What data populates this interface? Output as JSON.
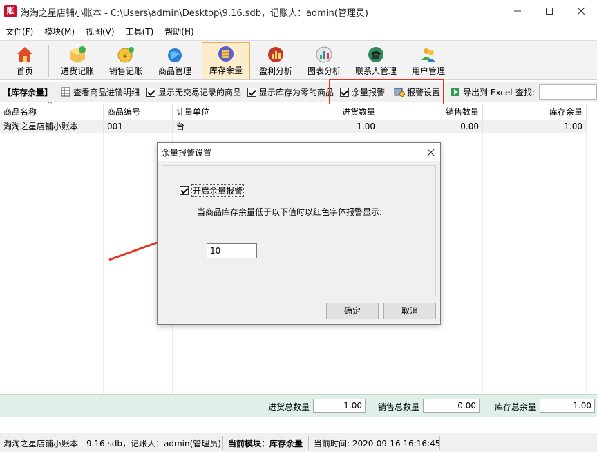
{
  "window": {
    "title": "淘淘之星店铺小账本 - C:\\Users\\admin\\Desktop\\9.16.sdb，记账人：admin(管理员)",
    "app_icon_text": "账"
  },
  "menu": [
    "文件(F)",
    "模块(M)",
    "视图(V)",
    "工具(T)",
    "帮助(H)"
  ],
  "toolbar": {
    "items": [
      "首页",
      "进货记账",
      "销售记账",
      "商品管理",
      "库存余量",
      "盈利分析",
      "图表分析",
      "联系人管理",
      "用户管理"
    ],
    "active": "库存余量"
  },
  "filterbar": {
    "module_label": "【库存余量】",
    "view_detail": "查看商品进销明细",
    "show_no_trade": "显示无交易记录的商品",
    "show_zero_stock": "显示库存为零的商品",
    "stock_alarm": "余量报警",
    "alarm_settings": "报警设置",
    "export_excel": "导出到 Excel",
    "search_label": "查找:",
    "search_value": ""
  },
  "table": {
    "columns": [
      "商品名称",
      "商品编号",
      "计量单位",
      "进货数量",
      "销售数量",
      "库存余量"
    ],
    "rows": [
      [
        "淘淘之星店铺小账本",
        "001",
        "台",
        "1.00",
        "0.00",
        "1.00"
      ]
    ]
  },
  "summary": {
    "in_total_label": "进货总数量",
    "in_total_value": "1.00",
    "sale_total_label": "销售总数量",
    "sale_total_value": "0.00",
    "stock_total_label": "库存总余量",
    "stock_total_value": "1.00"
  },
  "status": {
    "file_info": "淘淘之星店铺小账本 - 9.16.sdb，记账人：admin(管理员)",
    "module_label": "当前模块：",
    "module_value": "库存余量",
    "time": "当前时间: 2020-09-16 16:16:45"
  },
  "dialog": {
    "title": "余量报警设置",
    "enable_label": "开启余量报警",
    "prompt": "当商品库存余量低于以下值时以红色字体报警显示:",
    "threshold": "10",
    "ok": "确定",
    "cancel": "取消"
  },
  "colors": {
    "annotation_red": "#e8321e",
    "summary_bg": "#dff0e8",
    "active_tool_bg": "#fbeccb"
  }
}
